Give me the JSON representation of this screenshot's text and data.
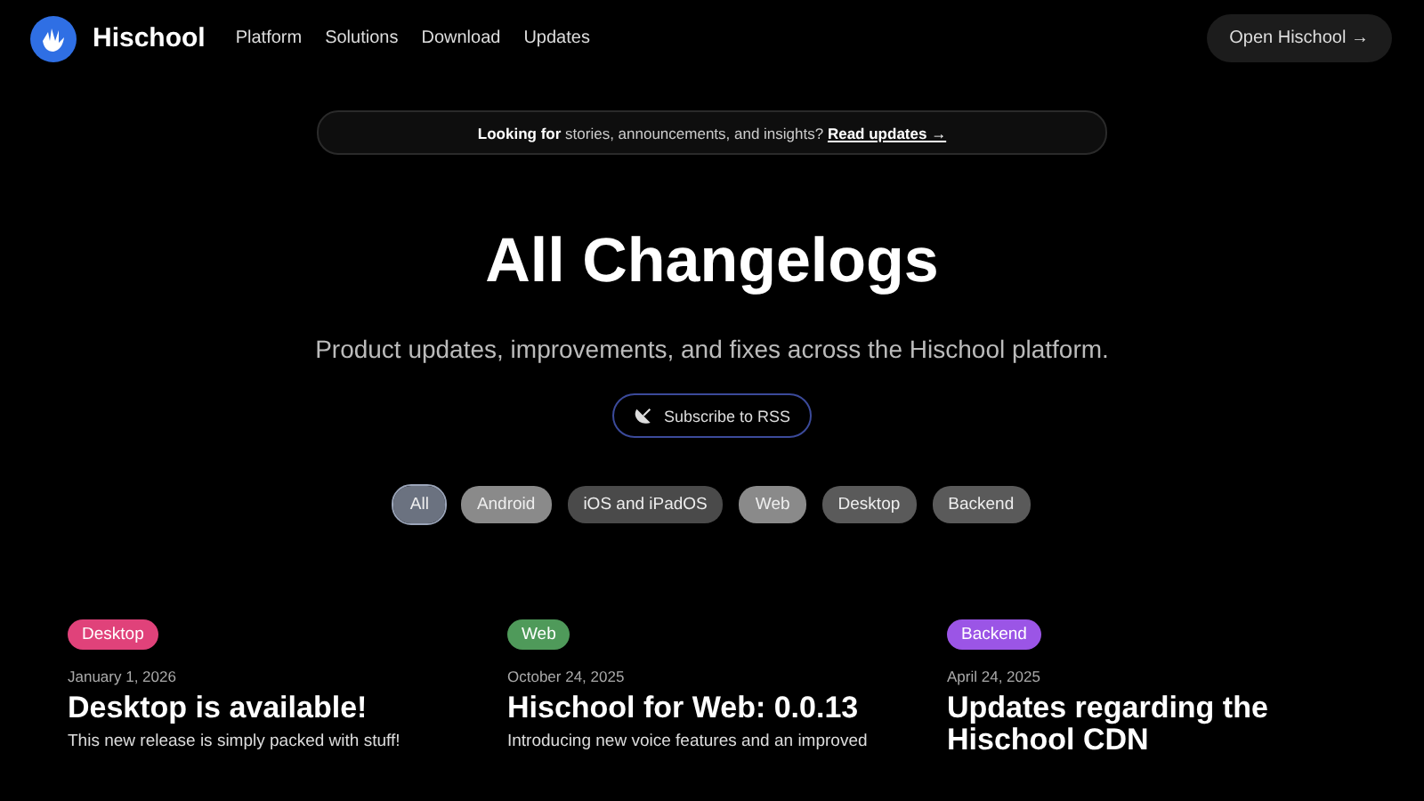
{
  "brand": {
    "name": "Hischool"
  },
  "nav": [
    "Platform",
    "Solutions",
    "Download",
    "Updates"
  ],
  "cta": {
    "label": "Open Hischool →"
  },
  "banner": {
    "text": "**Looking for** stories, announcements, and insights?",
    "link": "Read updates →"
  },
  "heading": "All Changelogs",
  "subtitle": "Product updates, improvements, and fixes across the Hischool platform.",
  "rss": {
    "label": "Subscribe to RSS"
  },
  "filters": [
    {
      "label": "All",
      "selected": true,
      "color": "#6b7280"
    },
    {
      "label": "Android",
      "selected": false,
      "color": "#8a8a8a"
    },
    {
      "label": "iOS and iPadOS",
      "selected": false,
      "color": "#4a4a4a"
    },
    {
      "label": "Web",
      "selected": false,
      "color": "#8a8a8a"
    },
    {
      "label": "Desktop",
      "selected": false,
      "color": "#5a5a5a"
    },
    {
      "label": "Backend",
      "selected": false,
      "color": "#5a5a5a"
    }
  ],
  "posts": [
    {
      "tag": "Desktop",
      "color": "#e0427a",
      "date": "January 1, 2026",
      "title": "Desktop is available!",
      "summary": "This new release is simply packed with stuff!"
    },
    {
      "tag": "Web",
      "color": "#4f9a5a",
      "date": "October 24, 2025",
      "title": "Hischool for Web: 0.0.13",
      "summary": "Introducing new voice features and an improved"
    },
    {
      "tag": "Backend",
      "color": "#9b55e6",
      "date": "April 24, 2025",
      "title": "Updates regarding the Hischool CDN"
    }
  ]
}
